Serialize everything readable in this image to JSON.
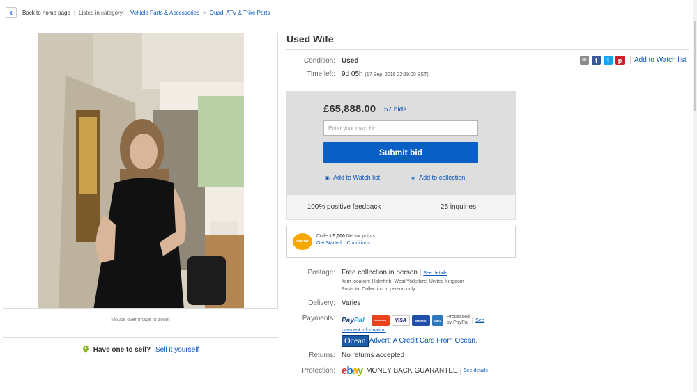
{
  "breadcrumb": {
    "back": "Back to home page",
    "listed": "Listed in category:",
    "cat1": "Vehicle Parts & Accessories",
    "sep": ">",
    "cat2": "Quad, ATV & Trike Parts"
  },
  "gallery": {
    "zoom_hint": "Mouse over image to zoom"
  },
  "sell": {
    "question": "Have one to sell?",
    "link": "Sell it yourself"
  },
  "item": {
    "title": "Used Wife",
    "condition_label": "Condition:",
    "condition": "Used",
    "time_label": "Time left:",
    "time_left": "9d 05h",
    "end_time": "(17 Sep, 2016   22:19:00 BST)"
  },
  "share": {
    "watch": "Add to Watch list"
  },
  "bid": {
    "price": "£65,888.00",
    "bids": "57 bids",
    "input_placeholder": "Enter your max. bid",
    "submit": "Submit bid",
    "watch": "Add to Watch list",
    "collection": "Add to collection"
  },
  "seller": {
    "feedback": "100% positive feedback",
    "inquiries": "25 inquiries"
  },
  "nectar": {
    "logo": "nectar",
    "collect_pre": "Collect ",
    "points": "5,000",
    "collect_post": " Nectar points",
    "get_started": "Get Started",
    "conditions": "Conditions"
  },
  "shipping": {
    "postage_label": "Postage:",
    "postage": "Free collection in person",
    "see": "See details",
    "item_location": "Item location:  Holmfirth, West Yorkshire, United Kingdom",
    "posts_to": "Posts to:  Collection in person only",
    "delivery_label": "Delivery:",
    "delivery": "Varies",
    "payments_label": "Payments:",
    "paypal_pay": "Pay",
    "paypal_pal": "Pal",
    "card_mc": "MasterCard",
    "card_visa": "VISA",
    "card_maestro": "Maestro",
    "card_amex": "AMEX",
    "processed": "Processed",
    "by_paypal": "by PayPal",
    "see_pay": "See",
    "payment_information": "payment information",
    "ocean": "Ocean",
    "ocean_advert": "Advert: A Credit Card From Ocean.",
    "returns_label": "Returns:",
    "returns": "No returns accepted",
    "protection_label": "Protection:",
    "ebay_e": "e",
    "ebay_b": "b",
    "ebay_a": "a",
    "ebay_y": "y",
    "guarantee": "MONEY BACK GUARANTEE",
    "see_details": "See details"
  }
}
